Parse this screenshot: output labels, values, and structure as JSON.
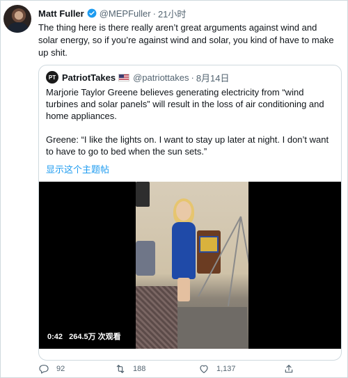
{
  "tweet": {
    "author_name": "Matt Fuller",
    "handle": "@MEPFuller",
    "separator": "·",
    "time": "21小时",
    "text": "The thing here is there really aren’t great arguments against wind and solar energy, so if you’re against wind and solar, you kind of have to make up shit."
  },
  "quoted_tweet": {
    "avatar_initials": "PT",
    "author_name": "PatriotTakes",
    "flag_icon": "us-flag-icon",
    "handle": "@patriottakes",
    "separator": "·",
    "time": "8月14日",
    "paragraph_1": "Marjorie Taylor Greene believes generating electricity from “wind turbines and solar panels” will result in the loss of air conditioning and home appliances.",
    "paragraph_2": "Greene: “I like the lights on. I want to stay up later at night. I don’t want to have to go to bed when the sun sets.”",
    "show_thread": "显示这个主题帖",
    "video": {
      "duration": "0:42",
      "views": "264.5万 次观看"
    }
  },
  "actions": {
    "reply_count": "92",
    "retweet_count": "188",
    "like_count": "1,137",
    "share_label": ""
  },
  "colors": {
    "accent": "#1d9bf0",
    "secondary_text": "#536471"
  }
}
